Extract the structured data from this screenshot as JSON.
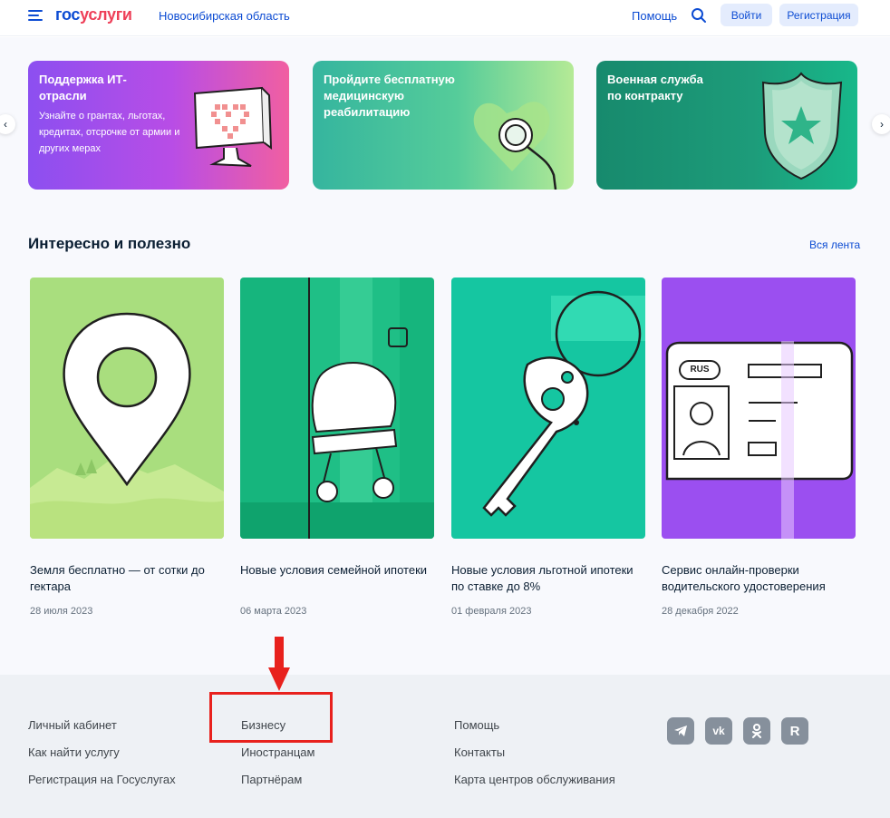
{
  "header": {
    "logo_part1": "гос",
    "logo_part2": "услуги",
    "region": "Новосибирская область",
    "help": "Помощь",
    "login": "Войти",
    "register": "Регистрация"
  },
  "banners": [
    {
      "title": "Поддержка ИТ-\nотрасли",
      "subtitle": "Узнайте о грантах, льготах, кредитах, отсрочке от армии и других мерах"
    },
    {
      "title": "Пройдите бесплатную медицинскую реабилитацию",
      "subtitle": ""
    },
    {
      "title": "Военная служба по контракту",
      "subtitle": ""
    }
  ],
  "section": {
    "title": "Интересно и полезно",
    "all_link": "Вся лента"
  },
  "cards": [
    {
      "title": "Земля бесплатно — от сотки до гектара",
      "date": "28 июля 2023"
    },
    {
      "title": "Новые условия семейной ипотеки",
      "date": "06 марта 2023"
    },
    {
      "title": "Новые условия льготной ипотеки по ставке до 8%",
      "date": "01 февраля 2023"
    },
    {
      "title": "Сервис онлайн-проверки водительского удостоверения",
      "date": "28 декабря 2022",
      "badge": "RUS"
    }
  ],
  "footer": {
    "col1": [
      "Личный кабинет",
      "Как найти услугу",
      "Регистрация на Госуслугах"
    ],
    "col2": [
      "Бизнесу",
      "Иностранцам",
      "Партнёрам"
    ],
    "col3": [
      "Помощь",
      "Контакты",
      "Карта центров обслуживания"
    ],
    "social": [
      "telegram-icon",
      "vk-icon",
      "ok-icon",
      "rutube-icon"
    ],
    "social_labels": [
      "",
      "vk",
      "",
      "R"
    ]
  },
  "colors": {
    "brand_blue": "#0d4cd3",
    "brand_red": "#ee3f58",
    "annotation_red": "#e8211d"
  }
}
